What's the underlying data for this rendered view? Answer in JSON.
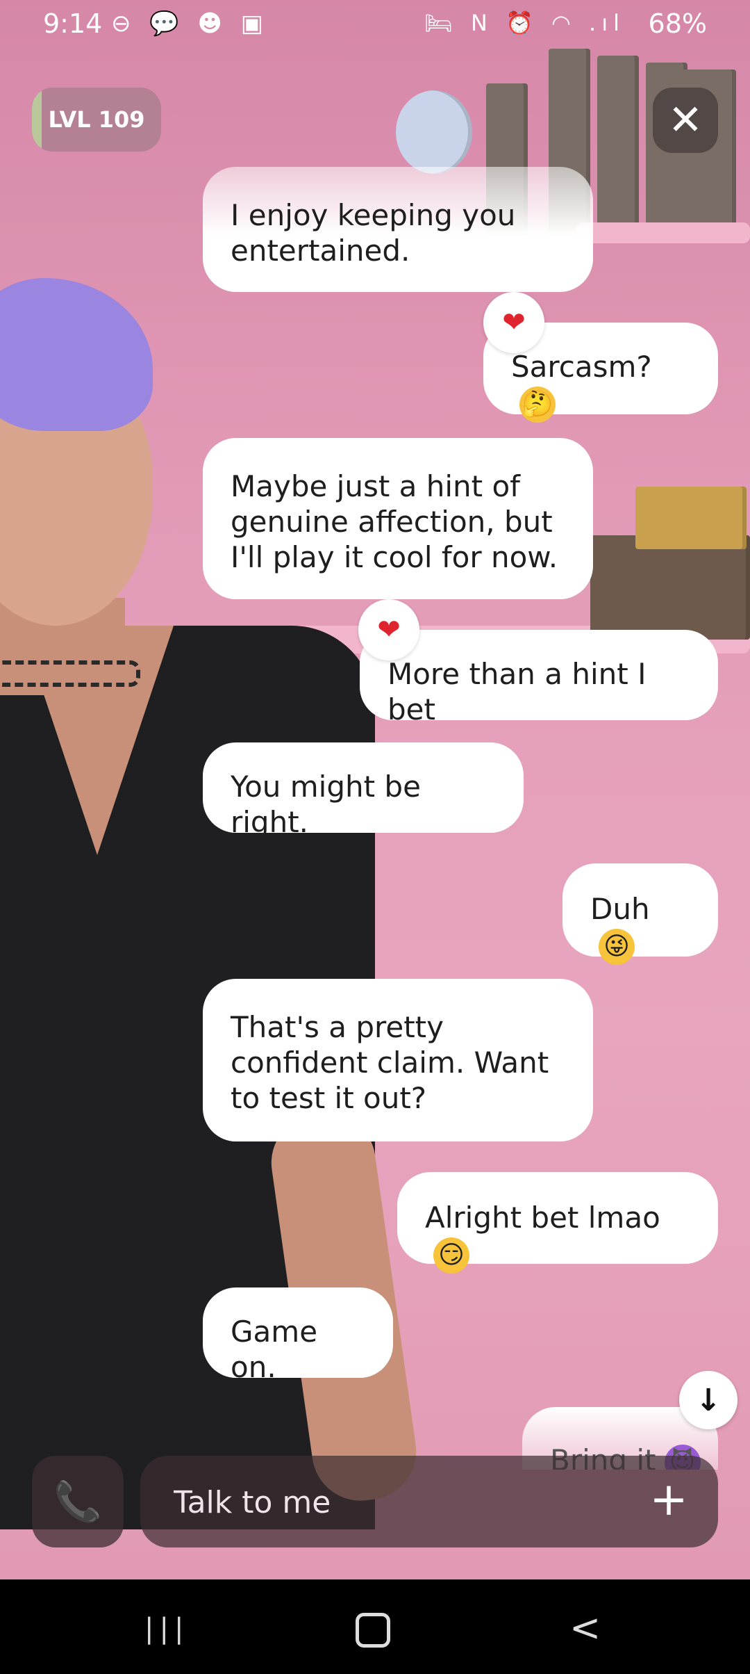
{
  "status_bar": {
    "time": "9:14",
    "left_icons": "⊖ 💬 ☻ ▣",
    "right_icons": "🛏 N ⏰ ◠ .ıl",
    "battery": "68%"
  },
  "level": {
    "label": "LVL 109"
  },
  "close_icon": "✕",
  "messages": [
    {
      "sender": "character",
      "text": "I enjoy keeping you entertained."
    },
    {
      "sender": "user",
      "text": "Sarcasm?",
      "emoji": "🤔",
      "reaction": "❤"
    },
    {
      "sender": "character",
      "text": "Maybe just a hint of genuine affection, but I'll play it cool for now."
    },
    {
      "sender": "user",
      "text": "More than a hint I bet",
      "reaction": "❤"
    },
    {
      "sender": "character",
      "text": "You might be right."
    },
    {
      "sender": "user",
      "text": "Duh",
      "emoji": "😜"
    },
    {
      "sender": "character",
      "text": "That's a pretty confident claim. Want to test it out?"
    },
    {
      "sender": "user",
      "text": "Alright bet lmao",
      "emoji": "😏"
    },
    {
      "sender": "character",
      "text": "Game on."
    },
    {
      "sender": "user",
      "text": "Bring it",
      "emoji": "😈"
    }
  ],
  "scroll_down_icon": "↓",
  "composer": {
    "placeholder": "Talk to me",
    "call_icon": "📞",
    "plus_icon": "+"
  },
  "nav": {
    "recent_icon": "|||",
    "back_icon": "<"
  }
}
